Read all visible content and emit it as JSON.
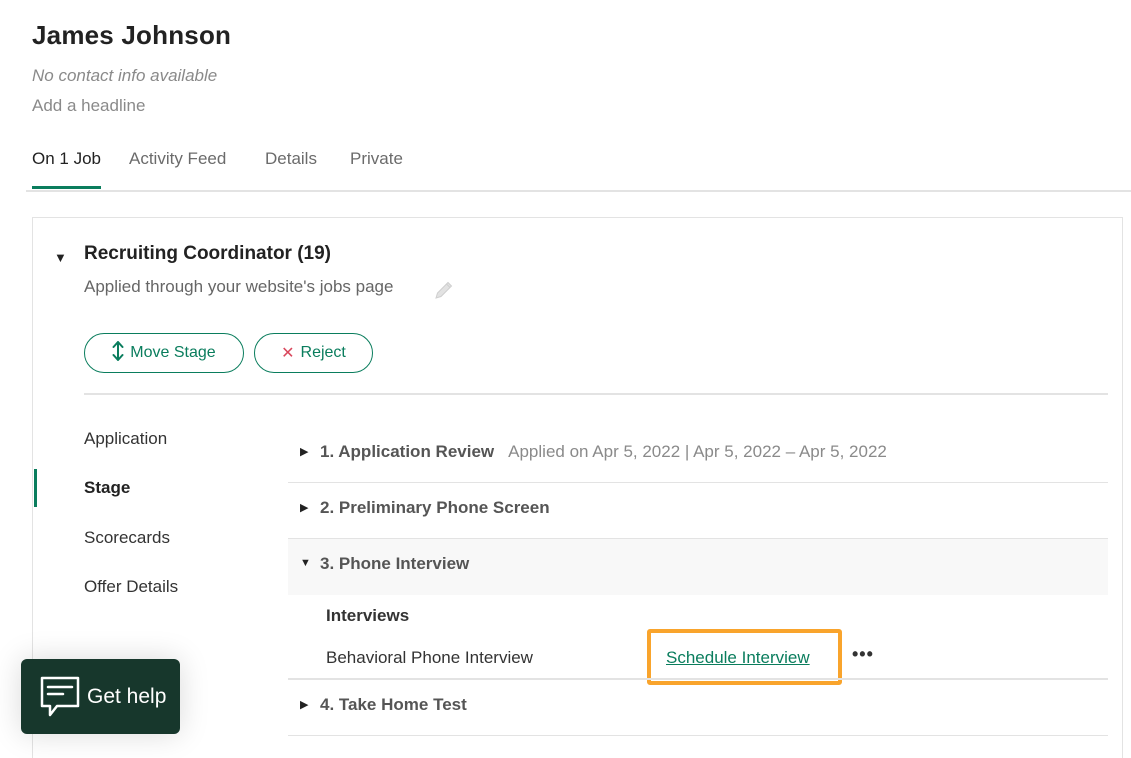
{
  "candidate": {
    "name": "James Johnson",
    "contact": "No contact info available",
    "headline_prompt": "Add a headline"
  },
  "tabs": [
    {
      "label": "On 1 Job",
      "active": true
    },
    {
      "label": "Activity Feed",
      "active": false
    },
    {
      "label": "Details",
      "active": false
    },
    {
      "label": "Private",
      "active": false
    }
  ],
  "job": {
    "title": "Recruiting Coordinator (19)",
    "source": "Applied through your website's jobs page",
    "actions": {
      "move_stage": "Move Stage",
      "reject": "Reject"
    }
  },
  "sidebar": {
    "items": [
      {
        "label": "Application",
        "active": false
      },
      {
        "label": "Stage",
        "active": true
      },
      {
        "label": "Scorecards",
        "active": false
      },
      {
        "label": "Offer Details",
        "active": false
      }
    ]
  },
  "stages": [
    {
      "title": "1.  Application Review",
      "dates": "Applied on Apr 5, 2022 | Apr 5, 2022 – Apr 5, 2022",
      "expanded": false
    },
    {
      "title": "2.  Preliminary Phone Screen",
      "dates": "",
      "expanded": false
    },
    {
      "title": "3.  Phone Interview",
      "dates": "",
      "expanded": true
    },
    {
      "title": "4.  Take Home Test",
      "dates": "",
      "expanded": false
    }
  ],
  "interviews": {
    "label": "Interviews",
    "items": [
      {
        "name": "Behavioral Phone Interview",
        "action": "Schedule Interview",
        "more": "•••"
      }
    ]
  },
  "help": {
    "label": "Get help"
  },
  "colors": {
    "accent": "#0a7d5d",
    "reject": "#d9475c",
    "highlight": "#f9a42c",
    "help_bg": "#17372c"
  }
}
